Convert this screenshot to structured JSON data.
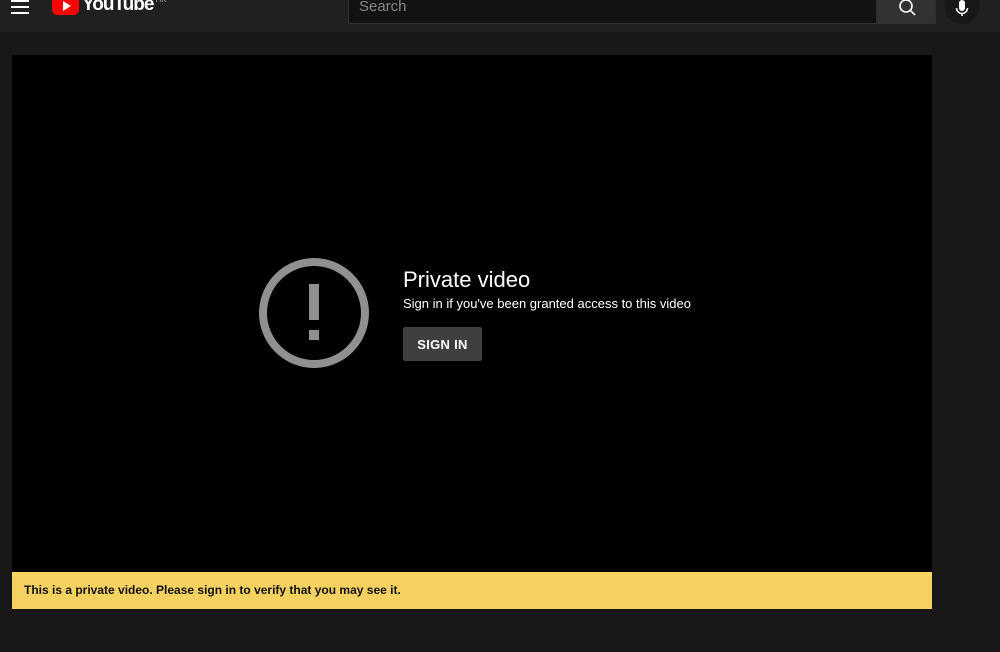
{
  "header": {
    "logo_text": "YouTube",
    "logo_country": "HK",
    "search_placeholder": "Search",
    "brand_color": "#ff0000"
  },
  "player": {
    "title": "Private video",
    "subtitle": "Sign in if you've been granted access to this video",
    "signin_label": "SIGN IN",
    "icon": "alert-circle-icon"
  },
  "notice": {
    "text": "This is a private video. Please sign in to verify that you may see it.",
    "color": "#f4d160"
  }
}
